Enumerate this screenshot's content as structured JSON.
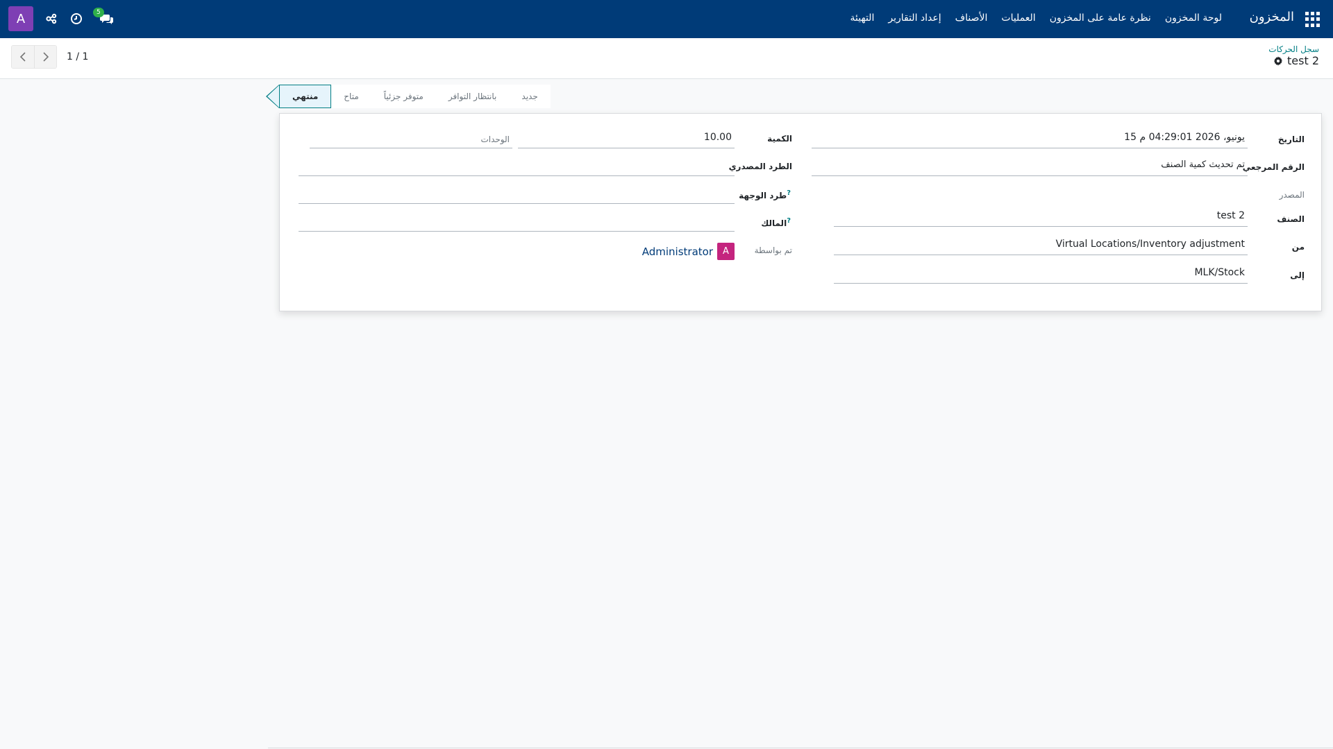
{
  "navbar": {
    "brand": "المخزون",
    "menu": [
      "لوحة المخزون",
      "نظرة عامة على المخزون",
      "العمليات",
      "الأصناف",
      "إعداد التقارير",
      "التهيئة"
    ],
    "chat_badge": "5",
    "user_initial": "A",
    "colors": {
      "bar": "#003b78",
      "avatar": "#7e3fb4"
    }
  },
  "breadcrumb": {
    "parent": "سجل الحركات",
    "current": "test 2"
  },
  "pager": {
    "text": "1 / 1"
  },
  "statusbar": {
    "stages": [
      "جديد",
      "بانتظار التوافر",
      "متوفر جزئياً",
      "متاح",
      "منتهي"
    ],
    "active": "منتهي"
  },
  "form": {
    "right": {
      "date_label": "التاريخ",
      "date_value": "15 يونيو، 2026 04:29:01 م",
      "ref_label": "الرقم المرجعي",
      "ref_value": "تم تحديث كمية الصنف",
      "source_label": "المصدر",
      "product_label": "الصنف",
      "product_value": "test 2",
      "from_label": "من",
      "from_value": "Virtual Locations/Inventory adjustment",
      "to_label": "إلى",
      "to_value": "MLK/Stock"
    },
    "left": {
      "qty_label": "الكمية",
      "qty_value": "10.00",
      "uom_placeholder": "الوحدات",
      "src_pkg_label": "الطرد المصدري",
      "dest_pkg_label": "طرد الوجهة",
      "owner_label": "المالك",
      "done_by_label": "تم بواسطة",
      "done_by_initial": "A",
      "done_by_value": "Administrator",
      "help_mark": "?"
    }
  }
}
